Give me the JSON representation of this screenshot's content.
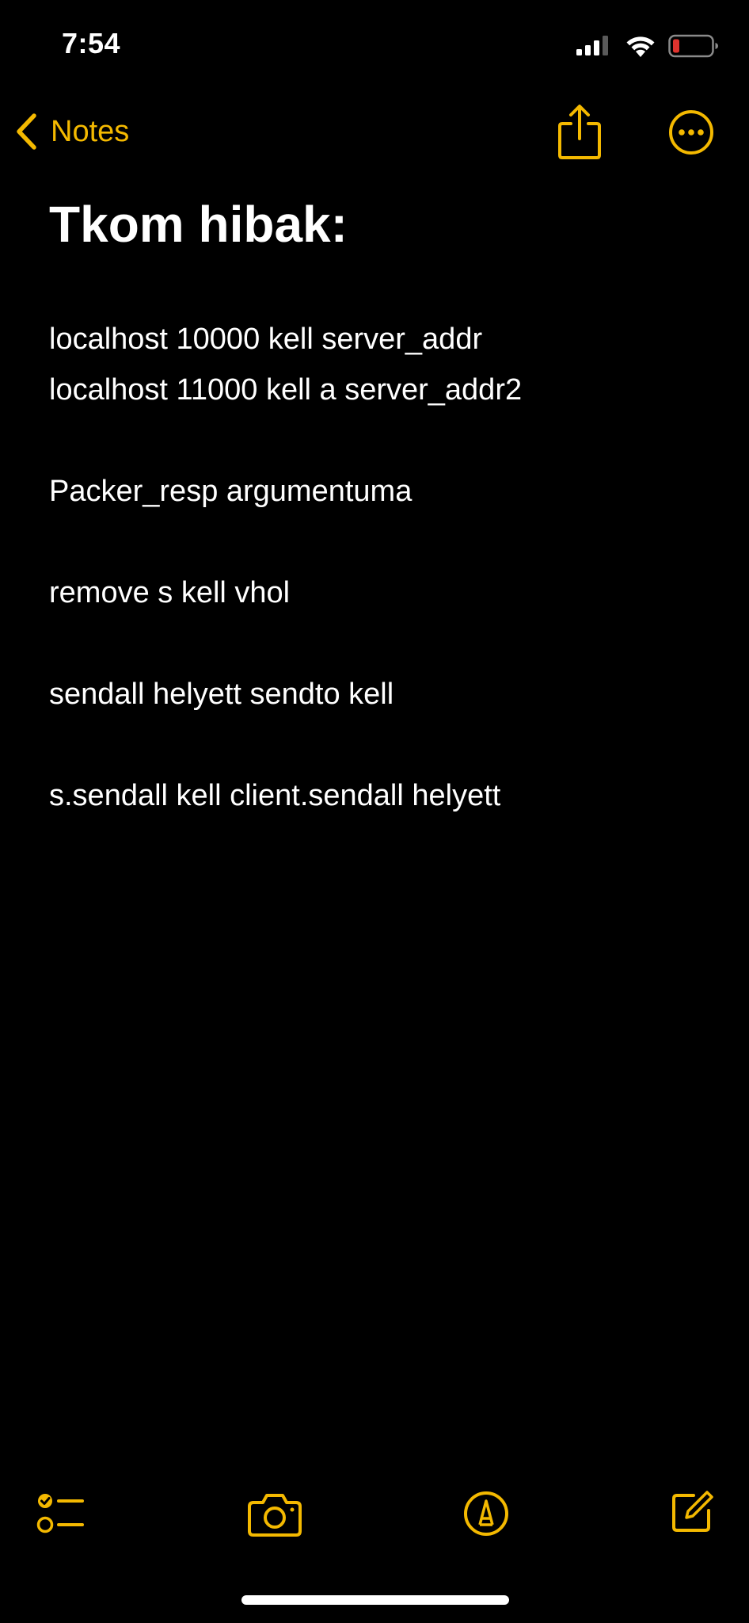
{
  "status_bar": {
    "time": "7:54"
  },
  "nav": {
    "back_label": "Notes"
  },
  "note": {
    "title": "Tkom hibak:",
    "paragraphs": [
      [
        "localhost 10000 kell server_addr",
        "localhost 11000 kell a server_addr2"
      ],
      [
        "Packer_resp argumentuma"
      ],
      [
        "remove s kell vhol"
      ],
      [
        "sendall helyett sendto kell"
      ],
      [
        "s.sendall kell client.sendall helyett"
      ]
    ]
  },
  "icons": {
    "back": "chevron-left-icon",
    "share": "share-icon",
    "more": "ellipsis-circle-icon",
    "checklist": "checklist-icon",
    "camera": "camera-icon",
    "markup": "markup-pen-icon",
    "compose": "compose-icon"
  },
  "colors": {
    "accent": "#f4b900",
    "background": "#000000",
    "text": "#ffffff",
    "battery_low": "#e0332e"
  }
}
